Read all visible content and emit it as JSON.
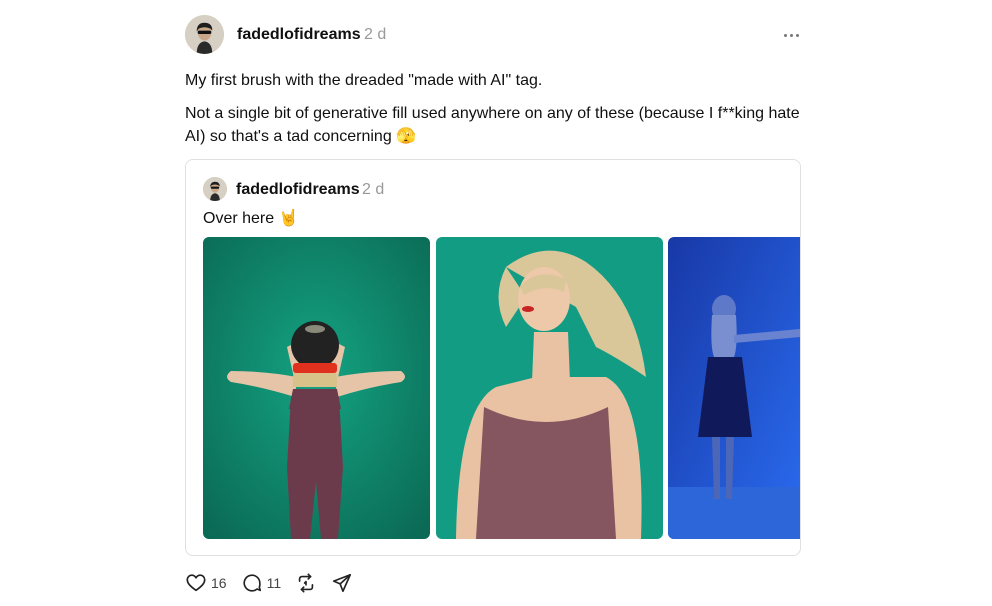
{
  "post": {
    "username": "fadedlofidreams",
    "timestamp": "2 d",
    "paragraphs": [
      "My first brush with the dreaded \"made with AI\" tag.",
      "Not a single bit of generative fill used anywhere on any of these (because I f**king hate AI) so that's a tad concerning 🫣"
    ]
  },
  "quoted_post": {
    "username": "fadedlofidreams",
    "timestamp": "2 d",
    "text": "Over here 🤘"
  },
  "actions": {
    "likes": "16",
    "replies": "11"
  },
  "icons": {
    "like": "heart-icon",
    "reply": "comment-icon",
    "repost": "repost-icon",
    "share": "send-icon",
    "more": "more-horizontal-icon"
  },
  "colors": {
    "text": "#101010",
    "muted": "#999999",
    "border": "#e0e0e0",
    "photo_green": "#0f8a6e",
    "photo_blue": "#1646c8"
  }
}
